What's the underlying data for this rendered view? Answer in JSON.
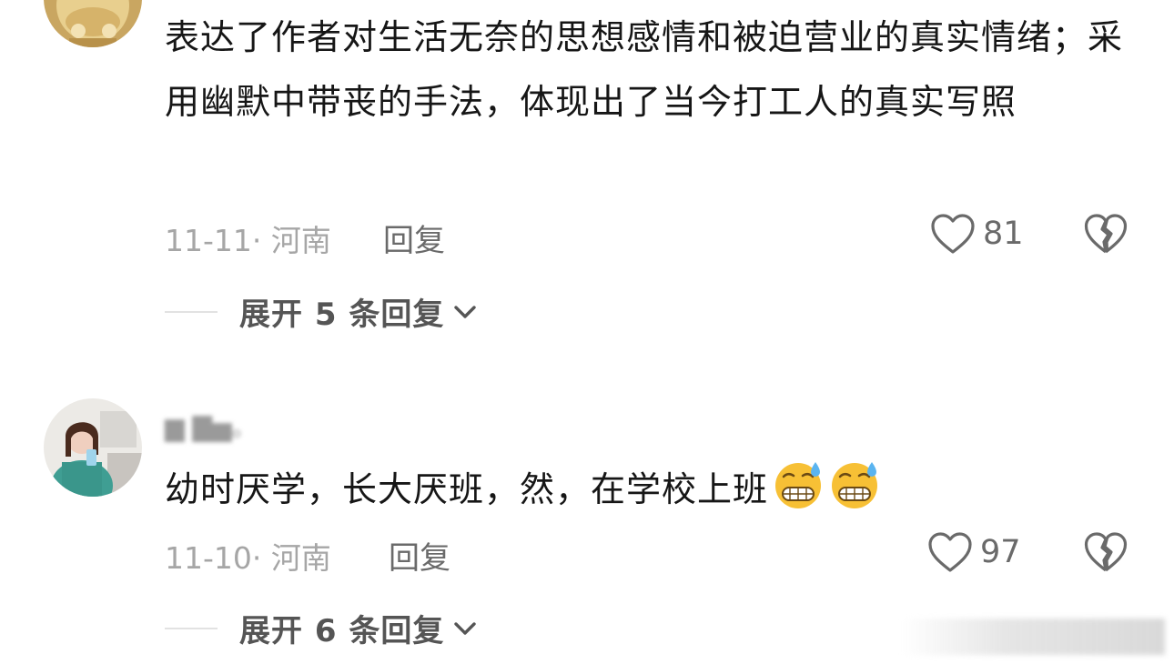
{
  "comments": [
    {
      "text": "表达了作者对生活无奈的思想感情和被迫营业的真实情绪；采用幽默中带丧的手法，体现出了当今打工人的真实写照",
      "date_location": "11-11· 河南",
      "reply_label": "回复",
      "likes": "81",
      "expand_label": "展开 5 条回复"
    },
    {
      "text": "幼时厌学，长大厌班，然，在学校上班",
      "date_location": "11-10· 河南",
      "reply_label": "回复",
      "likes": "97",
      "expand_label": "展开 6 条回复"
    }
  ],
  "icons": {
    "like": "heart-outline-icon",
    "dislike": "broken-heart-icon",
    "expand": "chevron-down-icon",
    "emoji": "grimacing-sweat-emoji"
  },
  "colors": {
    "text": "#161616",
    "meta": "#a6a6a6",
    "action": "#6a6a6a",
    "expand": "#555555"
  }
}
